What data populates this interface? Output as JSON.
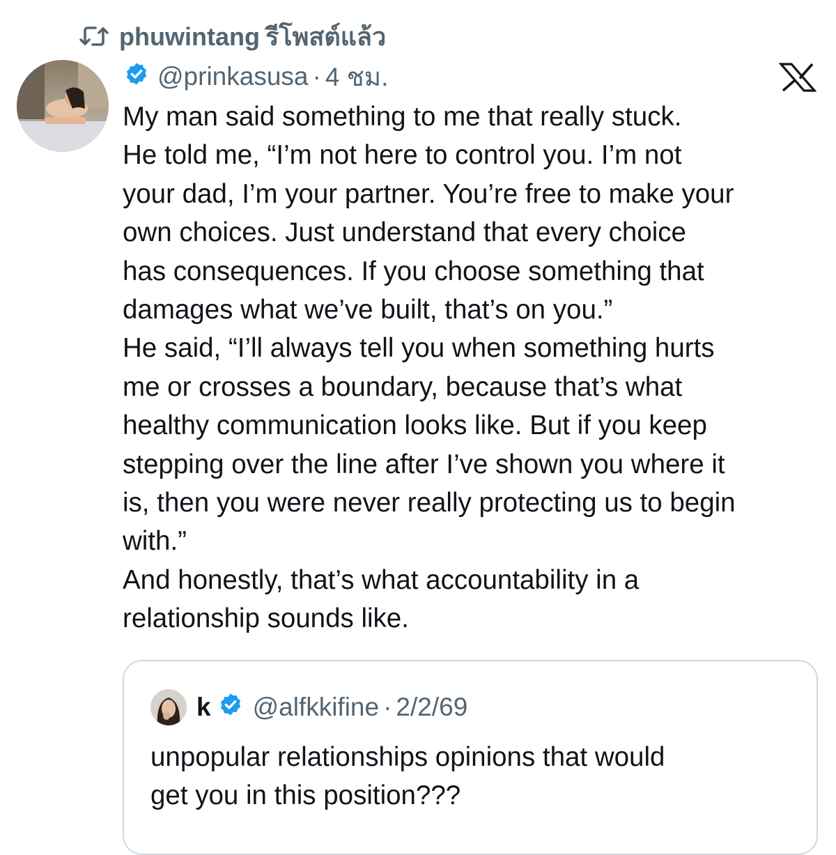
{
  "repost": {
    "username": "phuwintang",
    "label": "รีโพสต์แล้ว",
    "icon": "repost-icon"
  },
  "tweet": {
    "handle": "@prinkasusa",
    "separator": "·",
    "time": "4 ชม.",
    "verified_icon": "verified-badge-icon",
    "verified_color": "#1d9bf0",
    "avatar_icon": "profile-photo",
    "lines": [
      "My man said something to me that really stuck.",
      "He told me, “I’m not here to control you. I’m not",
      "your dad, I’m your partner. You’re free to make your",
      "own choices. Just understand that every choice",
      "has consequences. If you choose something that",
      "damages what we’ve built, that’s on you.”",
      "He said, “I’ll always tell you when something hurts",
      "me or crosses a boundary, because that’s what",
      "healthy communication looks like. But if you keep",
      "stepping over the line after I’ve shown you where it",
      "is, then you were never really protecting us to begin",
      "with.”",
      "And honestly, that’s what accountability in a",
      "relationship sounds like."
    ]
  },
  "brand": {
    "logo_icon": "x-logo-icon"
  },
  "quote": {
    "name": "k",
    "handle": "@alfkkifine",
    "separator": "·",
    "date": "2/2/69",
    "verified_icon": "verified-badge-icon",
    "avatar_icon": "profile-photo",
    "lines": [
      "unpopular relationships opinions that would",
      "get you in this position???"
    ]
  },
  "colors": {
    "text_primary": "#0f1419",
    "text_secondary": "#536471",
    "border": "#cfd9de",
    "verified": "#1d9bf0"
  }
}
